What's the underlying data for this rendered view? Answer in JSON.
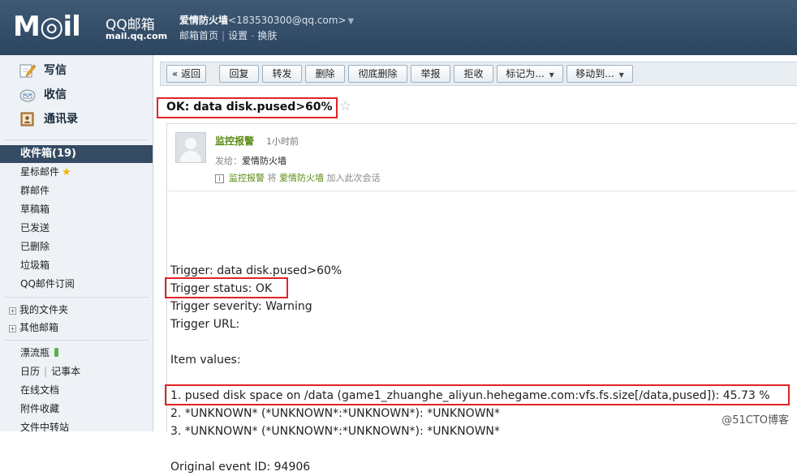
{
  "header": {
    "logo_text": "M◎il",
    "logo_qq": "QQ邮箱",
    "logo_url": "mail.qq.com",
    "user_name": "爱情防火墙",
    "user_email": "<183530300@qq.com>",
    "links": [
      "邮箱首页",
      "设置",
      "换肤"
    ]
  },
  "sidebar": {
    "top_items": [
      {
        "label": "写信",
        "icon": "pencil-icon"
      },
      {
        "label": "收信",
        "icon": "inbox-icon"
      },
      {
        "label": "通讯录",
        "icon": "contacts-icon"
      }
    ],
    "inbox_label": "收件箱(19)",
    "items": [
      "星标邮件",
      "群邮件",
      "草稿箱",
      "已发送",
      "已删除",
      "垃圾箱",
      "QQ邮件订阅"
    ],
    "folders": [
      "我的文件夹",
      "其他邮箱"
    ],
    "tools": [
      "漂流瓶",
      "日历",
      "记事本",
      "在线文档",
      "附件收藏",
      "文件中转站"
    ]
  },
  "toolbar": {
    "buttons": [
      "« 返回",
      "回复",
      "转发",
      "删除",
      "彻底删除",
      "举报",
      "拒收",
      "标记为...",
      "移动到..."
    ]
  },
  "mail": {
    "subject": "OK: data disk.pused>60%",
    "sender": "监控报警",
    "time": "1小时前",
    "to_label": "发给：",
    "to_name": "爱情防火墙",
    "info_sender": "监控报警",
    "info_mid": " 将 ",
    "info_target": "爱情防火墙",
    "info_tail": " 加入此次会话",
    "lines": [
      "Trigger: data disk.pused>60%",
      "Trigger status: OK",
      "Trigger severity: Warning",
      "Trigger URL:",
      "",
      "Item values:",
      "",
      "1. pused disk space on /data (game1_zhuanghe_aliyun.hehegame.com:vfs.fs.size[/data,pused]): 45.73 %",
      "2. *UNKNOWN* (*UNKNOWN*:*UNKNOWN*): *UNKNOWN*",
      "3. *UNKNOWN* (*UNKNOWN*:*UNKNOWN*): *UNKNOWN*",
      "",
      "Original event ID: 94906"
    ]
  },
  "watermark": "@51CTO博客",
  "colors": {
    "header_bg": "#34506b",
    "sidebar_active": "#344b63",
    "highlight_box": "#e02424",
    "sender_green": "#5b8b16"
  }
}
